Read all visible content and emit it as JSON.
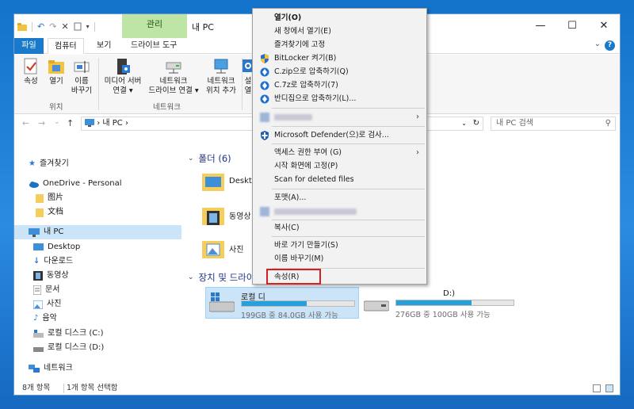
{
  "titlebar": {
    "management_tab": "관리",
    "window_title": "내 PC",
    "minimize": "—",
    "maximize": "☐",
    "close": "✕",
    "help": "?"
  },
  "ribbon_tabs": {
    "file": "파일",
    "computer": "컴퓨터",
    "view": "보기",
    "drive_tools": "드라이브 도구"
  },
  "ribbon": {
    "properties": "속성",
    "open": "열기",
    "rename_line1": "이름",
    "rename_line2": "바꾸기",
    "location_group": "위치",
    "media_server_line1": "미디어 서버",
    "media_server_line2": "연결 ▾",
    "network_drive_line1": "네트워크",
    "network_drive_line2": "드라이브 연결 ▾",
    "network_location_line1": "네트워크",
    "network_location_line2": "위치 추가",
    "network_group": "네트워크",
    "settings_line1": "설",
    "settings_line2": "열"
  },
  "address": {
    "path_root": "›",
    "path_item": "내 PC",
    "path_chevron": "›",
    "search_placeholder": "내 PC 검색"
  },
  "nav": {
    "quick_access": "즐겨찾기",
    "onedrive": "OneDrive - Personal",
    "pictures_od": "图片",
    "documents_od": "文档",
    "this_pc": "내 PC",
    "desktop": "Desktop",
    "downloads": "다운로드",
    "videos": "동영상",
    "documents": "문서",
    "pictures": "사진",
    "music": "음악",
    "local_c": "로컬 디스크 (C:)",
    "local_d": "로컬 디스크 (D:)",
    "network": "네트워크"
  },
  "content": {
    "folders_header": "폴더 (6)",
    "folders": [
      "Desktop",
      "동영상",
      "사진"
    ],
    "devices_header": "장치 및 드라이",
    "drive_c_name": "로컬 디",
    "drive_c_free": "199GB 중 84.0GB 사용 가능",
    "drive_c_fill": 0.58,
    "drive_d_name": "D:)",
    "drive_d_free": "276GB 중 100GB 사용 가능",
    "drive_d_fill": 0.64
  },
  "status": {
    "item_count": "8개 항목",
    "selected": "1개 항목 선택함"
  },
  "context_menu": {
    "open": "열기(O)",
    "open_new_window": "새 창에서 열기(E)",
    "pin_quick": "즐겨찾기에 고정",
    "bitlocker": "BitLocker 켜기(B)",
    "zip": "C.zip으로 압축하기(Q)",
    "seven_z": "C.7z로 압축하기(7)",
    "bandizip": "반디집으로 압축하기(L)...",
    "defender": "Microsoft Defender(으)로 검사...",
    "access": "액세스 권한 부여 (G)",
    "pin_start": "시작 화면에 고정(P)",
    "scan_deleted": "Scan for deleted files",
    "format": "포맷(A)...",
    "copy": "복사(C)",
    "shortcut": "바로 가기 만들기(S)",
    "rename": "이름 바꾸기(M)",
    "properties": "속성(R)",
    "submenu_arrow": "›"
  },
  "colors": {
    "accent": "#1979ca",
    "selection": "#cce4f7",
    "highlight_border": "#d42020",
    "drive_bar": "#26a0da"
  }
}
